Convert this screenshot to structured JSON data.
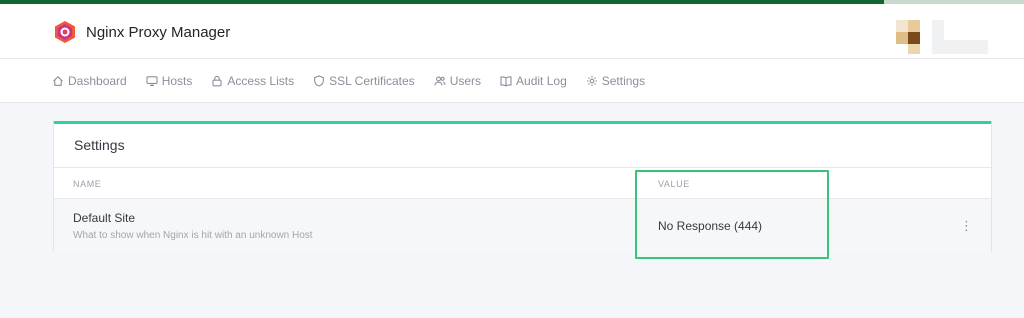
{
  "app": {
    "title": "Nginx Proxy Manager"
  },
  "nav": {
    "items": [
      {
        "label": "Dashboard",
        "icon": "home-icon"
      },
      {
        "label": "Hosts",
        "icon": "monitor-icon"
      },
      {
        "label": "Access Lists",
        "icon": "lock-icon"
      },
      {
        "label": "SSL Certificates",
        "icon": "shield-icon"
      },
      {
        "label": "Users",
        "icon": "users-icon"
      },
      {
        "label": "Audit Log",
        "icon": "book-icon"
      },
      {
        "label": "Settings",
        "icon": "gear-icon"
      }
    ]
  },
  "settings": {
    "title": "Settings",
    "columns": [
      "NAME",
      "VALUE"
    ],
    "rows": [
      {
        "name": "Default Site",
        "description": "What to show when Nginx is hit with an unknown Host",
        "value": "No Response (444)"
      }
    ]
  },
  "colors": {
    "accent": "#2fd0a6",
    "topbar": "#116530",
    "highlight": "#36c47a"
  }
}
